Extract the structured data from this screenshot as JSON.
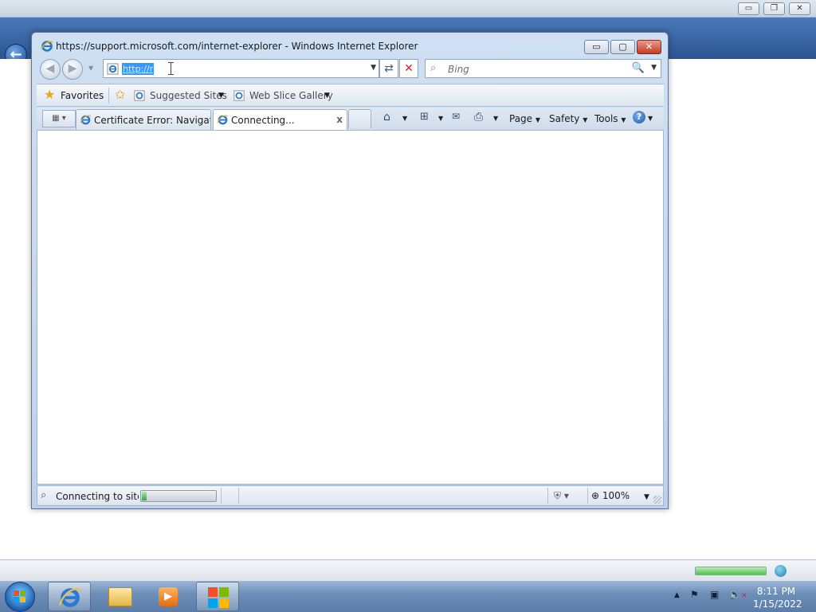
{
  "outer": {
    "controls": {
      "minimize": "▭",
      "restore": "❐",
      "close": "✕"
    },
    "back_glyph": "←"
  },
  "window": {
    "title": "https://support.microsoft.com/internet-explorer - Windows Internet Explorer",
    "controls": {
      "minimize": "▭",
      "maximize": "▢",
      "close": "✕"
    }
  },
  "nav": {
    "back_glyph": "◀",
    "forward_glyph": "▶",
    "history_glyph": "▼"
  },
  "address": {
    "value": "http://r",
    "dropdown_glyph": "▼",
    "refresh_glyph": "⇄",
    "stop_glyph": "✕"
  },
  "search": {
    "placeholder": "Bing",
    "go_glyph": "🔍",
    "dropdown_glyph": "▼"
  },
  "favorites_bar": {
    "favorites_label": "Favorites",
    "items": [
      {
        "label": "Suggested Sites",
        "icon": "ie-page-icon"
      },
      {
        "label": "Web Slice Gallery",
        "icon": "ie-page-icon"
      }
    ]
  },
  "tabs": {
    "items": [
      {
        "label": "Certificate Error: Navigati...",
        "active": false
      },
      {
        "label": "Connecting...",
        "active": true,
        "close_glyph": "x"
      }
    ]
  },
  "command_bar": {
    "page_label": "Page",
    "safety_label": "Safety",
    "tools_label": "Tools",
    "help_glyph": "?"
  },
  "status": {
    "text": "Connecting to site :",
    "progress_percent": 6,
    "zoom": "100%"
  },
  "taskbar": {
    "clock_time": "8:11 PM",
    "clock_date": "1/15/2022"
  },
  "colors": {
    "accent": "#2b5591",
    "selection": "#3399ff",
    "progress_green": "#2ea83b"
  }
}
